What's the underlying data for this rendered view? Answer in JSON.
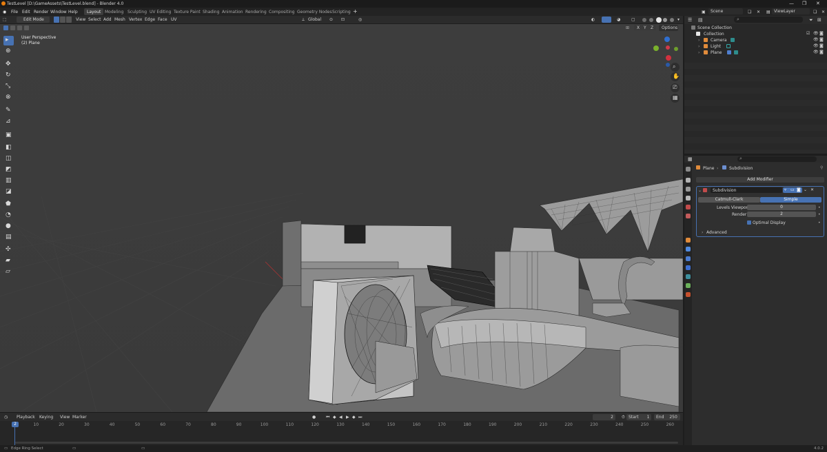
{
  "window": {
    "title": "TestLevel [D:\\GameAssets\\TestLevel.blend] - Blender 4.0"
  },
  "menu": {
    "items": [
      "File",
      "Edit",
      "Render",
      "Window",
      "Help"
    ],
    "workspaces": [
      "Layout",
      "Modeling",
      "Sculpting",
      "UV Editing",
      "Texture Paint",
      "Shading",
      "Animation",
      "Rendering",
      "Compositing",
      "Geometry Nodes",
      "Scripting"
    ],
    "active_workspace": "Layout",
    "add_workspace": "+",
    "scene": "Scene",
    "view_layer": "ViewLayer"
  },
  "viewport": {
    "mode": "Edit Mode",
    "menus": [
      "View",
      "Select",
      "Add",
      "Mesh",
      "Vertex",
      "Edge",
      "Face",
      "UV"
    ],
    "orientation": "Global",
    "options": "Options",
    "axes": [
      "X",
      "Y",
      "Z"
    ],
    "overlay_line1": "User Perspective",
    "overlay_line2": "(2) Plane",
    "gizmo": {
      "x": "X",
      "y": "Y",
      "z": "Z"
    }
  },
  "timeline": {
    "menus": [
      "Playback",
      "Keying",
      "View",
      "Marker"
    ],
    "current_frame": "2",
    "start_label": "Start",
    "start": "1",
    "end_label": "End",
    "end": "250",
    "ticks": [
      "10",
      "20",
      "30",
      "40",
      "50",
      "60",
      "70",
      "80",
      "90",
      "100",
      "110",
      "120",
      "130",
      "140",
      "150",
      "160",
      "170",
      "180",
      "190",
      "200",
      "210",
      "220",
      "230",
      "240",
      "250",
      "260"
    ],
    "playhead": "2"
  },
  "status": {
    "left": "Edge Ring Select",
    "version": "4.0.2"
  },
  "outliner": {
    "title": "Scene Collection",
    "items": [
      {
        "name": "Collection",
        "color": "#9a9a9a"
      },
      {
        "name": "Camera",
        "color": "#e08b3b"
      },
      {
        "name": "Light",
        "color": "#e08b3b"
      },
      {
        "name": "Plane",
        "color": "#e08b3b"
      }
    ]
  },
  "properties": {
    "breadcrumb_object": "Plane",
    "breadcrumb_modifier": "Subdivision",
    "add_modifier": "Add Modifier",
    "modifier_name": "Subdivision",
    "tab_catmull": "Catmull-Clark",
    "tab_simple": "Simple",
    "levels_viewport_label": "Levels Viewport",
    "levels_viewport": "0",
    "render_label": "Render",
    "render": "2",
    "optimal_display": "Optimal Display",
    "advanced": "Advanced"
  },
  "colors": {
    "accent": "#4772b3",
    "orange": "#e87d0d",
    "panel": "#2d2d2d"
  }
}
